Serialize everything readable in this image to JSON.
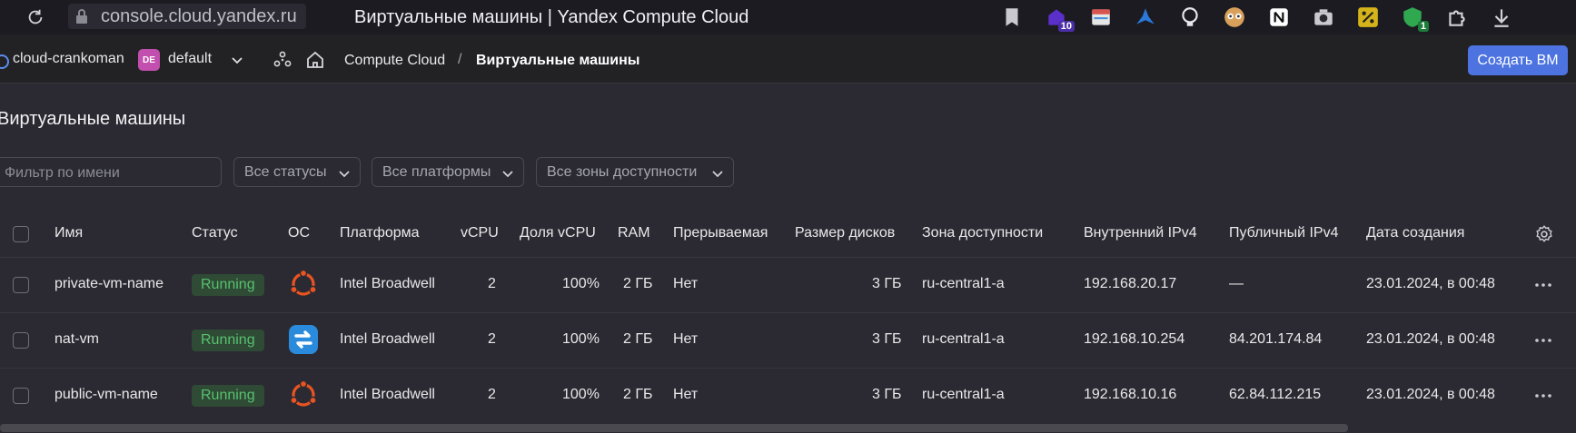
{
  "browser": {
    "url": "console.cloud.yandex.ru",
    "tab_title": "Виртуальные машины | Yandex Compute Cloud",
    "extension_badges": {
      "ext1": "10",
      "ext10": "1"
    }
  },
  "header": {
    "cloud_name": "cloud-crankoman",
    "folder_initials": "DE",
    "folder_name": "default",
    "breadcrumb": [
      "Compute Cloud",
      "/",
      "Виртуальные машины"
    ],
    "create_button": "Создать ВМ"
  },
  "page": {
    "title": "Виртуальные машины",
    "filters": {
      "name_placeholder": "Фильтр по имени",
      "status": "Все статусы",
      "platform": "Все платформы",
      "zone": "Все зоны доступности"
    }
  },
  "table": {
    "columns": [
      "Имя",
      "Статус",
      "ОС",
      "Платформа",
      "vCPU",
      "Доля vCPU",
      "RAM",
      "Прерываемая",
      "Размер дисков",
      "Зона доступности",
      "Внутренний IPv4",
      "Публичный IPv4",
      "Дата создания"
    ],
    "rows": [
      {
        "name": "private-vm-name",
        "status": "Running",
        "os": "ubuntu-icon",
        "platform": "Intel Broadwell",
        "vcpu": "2",
        "vcpu_share": "100%",
        "ram": "2 ГБ",
        "preemptible": "Нет",
        "disk": "3 ГБ",
        "zone": "ru-central1-a",
        "ipv4_internal": "192.168.20.17",
        "ipv4_public": "—",
        "created": "23.01.2024, в 00:48"
      },
      {
        "name": "nat-vm",
        "status": "Running",
        "os": "nat-instance-icon",
        "platform": "Intel Broadwell",
        "vcpu": "2",
        "vcpu_share": "100%",
        "ram": "2 ГБ",
        "preemptible": "Нет",
        "disk": "3 ГБ",
        "zone": "ru-central1-a",
        "ipv4_internal": "192.168.10.254",
        "ipv4_public": "84.201.174.84",
        "created": "23.01.2024, в 00:48"
      },
      {
        "name": "public-vm-name",
        "status": "Running",
        "os": "ubuntu-icon",
        "platform": "Intel Broadwell",
        "vcpu": "2",
        "vcpu_share": "100%",
        "ram": "2 ГБ",
        "preemptible": "Нет",
        "disk": "3 ГБ",
        "zone": "ru-central1-a",
        "ipv4_internal": "192.168.10.16",
        "ipv4_public": "62.84.112.215",
        "created": "23.01.2024, в 00:48"
      }
    ]
  },
  "colors": {
    "accent": "#4c73e0",
    "status_running_bg": "#2f4a35",
    "status_running_fg": "#57c16f",
    "ubuntu": "#e95420",
    "nat": "#2a8bdc",
    "folder_avatar": "#c24fae"
  }
}
